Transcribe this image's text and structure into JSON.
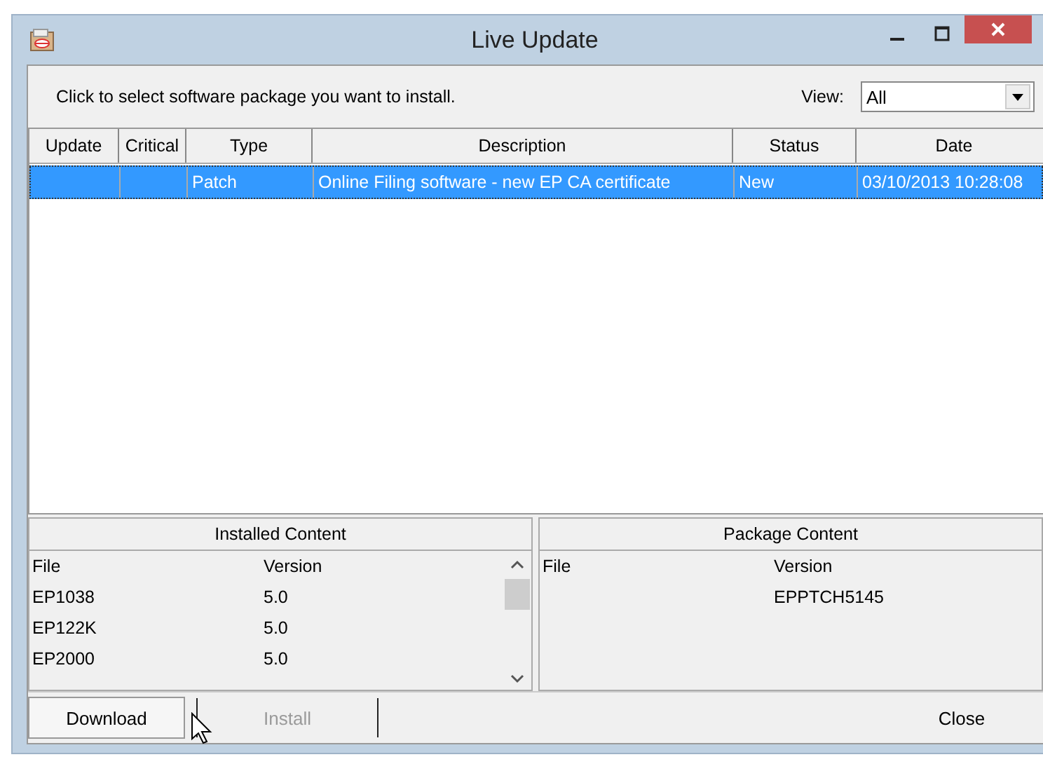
{
  "window": {
    "title": "Live Update"
  },
  "toolbar": {
    "instruction": "Click to select software package you want  to install.",
    "view_label": "View:",
    "view_value": "All"
  },
  "table": {
    "columns": [
      "Update",
      "Critical",
      "Type",
      "Description",
      "Status",
      "Date"
    ],
    "rows": [
      {
        "selected": true,
        "cells": [
          "",
          "",
          "Patch",
          "Online Filing software - new EP CA certificate",
          "New",
          "03/10/2013 10:28:08"
        ]
      }
    ]
  },
  "installed_content": {
    "title": "Installed Content",
    "columns": [
      "File",
      "Version"
    ],
    "rows": [
      {
        "file": "EP1038",
        "version": "5.0"
      },
      {
        "file": "EP122K",
        "version": "5.0"
      },
      {
        "file": "EP2000",
        "version": "5.0"
      }
    ]
  },
  "package_content": {
    "title": "Package Content",
    "columns": [
      "File",
      "Version"
    ],
    "rows": [
      {
        "version": "EPPTCH5145"
      }
    ]
  },
  "buttons": [
    {
      "label": "Download",
      "disabled": false
    },
    {
      "label": "Install",
      "disabled": true
    },
    {
      "label": "Close",
      "disabled": false
    }
  ]
}
